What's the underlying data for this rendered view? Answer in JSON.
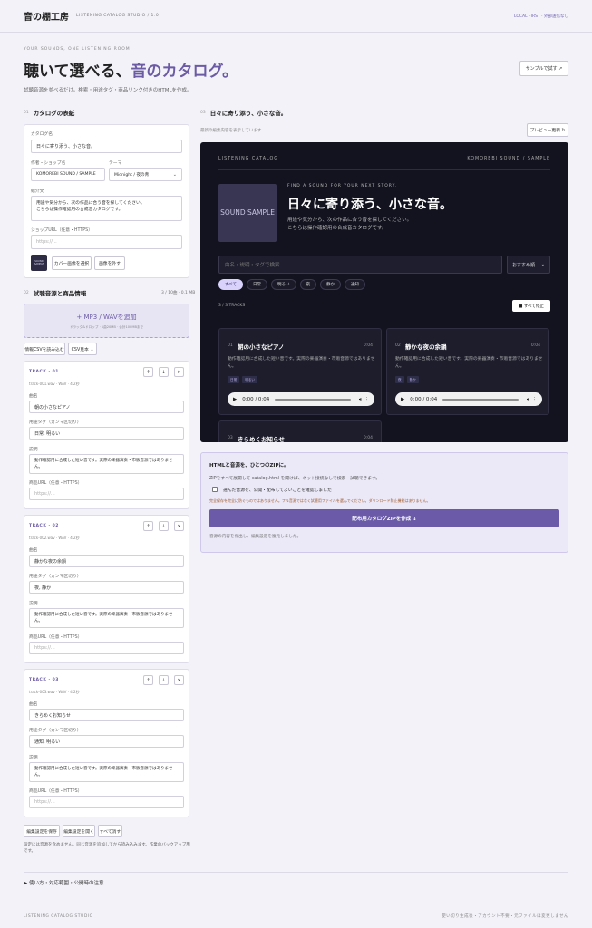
{
  "header": {
    "logo": "音の棚工房",
    "subtitle": "LISTENING CATALOG STUDIO / 1.0",
    "right": "LOCAL FIRST · 外部送信なし"
  },
  "hero": {
    "kicker": "YOUR SOUNDS, ONE LISTENING ROOM",
    "title_a": "聴いて選べる、",
    "title_b": "音のカタログ。",
    "subtitle": "試聴音源を並べるだけ。検索・用途タグ・商品リンク付きのHTMLを作成。",
    "sample_button": "サンプルで試す ↗"
  },
  "cover_section": {
    "num": "01",
    "title": "カタログの表紙",
    "catalog_name_label": "カタログ名",
    "catalog_name": "日々に寄り添う、小さな音。",
    "author_label": "作者・ショップ名",
    "author": "KOMOREBI SOUND / SAMPLE",
    "theme_label": "テーマ",
    "theme": "Midnight / 夜の青",
    "intro_label": "紹介文",
    "intro": "用途や気分から、次の作品に合う音を探してください。\nこちらは操作確認用の合成音カタログです。",
    "shop_label": "ショップURL（任意・HTTPS）",
    "shop_placeholder": "https://...",
    "cover_thumb": "SOUND SAMPLE",
    "select_cover": "カバー画像を選択",
    "remove_cover": "画像を外す"
  },
  "tracks_section": {
    "num": "02",
    "title": "試聴音源と商品情報",
    "counter": "3 / 10曲 · 0.1 MB",
    "drop_title": "+ MP3 / WAVを追加",
    "drop_sub": "ドラッグ&ドロップ · 1曲20MB · 合計100MBまで",
    "csv_import": "情報CSVを読み込む",
    "csv_template": "CSV見本 ↓",
    "labels": {
      "name": "曲名",
      "tags": "用途タグ（カンマ区切り）",
      "desc": "説明",
      "url": "商品URL（任意・HTTPS）"
    },
    "url_placeholder": "https://...",
    "tracks": [
      {
        "head": "TRACK · 01",
        "meta": "track-001.wav · WAV · 4.2秒",
        "name": "朝の小さなピアノ",
        "tags": "日常, 明るい",
        "desc": "動作確認用に合成した短い音です。実際の楽器演奏・市販音源ではありません。"
      },
      {
        "head": "TRACK · 02",
        "meta": "track-002.wav · WAV · 4.2秒",
        "name": "静かな夜の余韻",
        "tags": "夜, 静か",
        "desc": "動作確認用に合成した短い音です。実際の楽器演奏・市販音源ではありません。"
      },
      {
        "head": "TRACK · 03",
        "meta": "track-003.wav · WAV · 4.2秒",
        "name": "きらめくお知らせ",
        "tags": "通知, 明るい",
        "desc": "動作確認用に合成した短い音です。実際の楽器演奏・市販音源ではありません。"
      }
    ],
    "icon_up": "↑",
    "icon_down": "↓",
    "icon_remove": "×",
    "save_settings": "編集設定を保存",
    "open_settings": "編集設定を開く",
    "clear_all": "すべて消す",
    "note": "設定には音源を含めません。同じ音源を追加してから読み込みます。作業のバックアップ用です。"
  },
  "preview_section": {
    "num": "03",
    "title": "日々に寄り添う、小さな音。",
    "note": "最新の編集内容を表示しています",
    "refresh": "プレビュー更新 ↻",
    "top_left": "LISTENING CATALOG",
    "top_right": "KOMOREBI SOUND / SAMPLE",
    "cover": "SOUND SAMPLE",
    "kicker": "FIND A SOUND FOR YOUR NEXT STORY.",
    "desc": "用途や気分から、次の作品に合う音を探してください。\nこちらは操作確認用の合成音カタログです。",
    "search_placeholder": "曲名・説明・タグで検索",
    "sort": "おすすめ順",
    "chips": [
      "すべて",
      "日常",
      "明るい",
      "夜",
      "静か",
      "通知"
    ],
    "count": "3 / 3 TRACKS",
    "stop_all": "■ すべて停止",
    "cards": [
      {
        "num": "01",
        "title": "朝の小さなピアノ",
        "dur": "0:04",
        "desc": "動作確認用に合成した短い音です。実際の楽器演奏・市販音源ではありません。",
        "tags": [
          "日常",
          "明るい"
        ],
        "time": "0:00 / 0:04"
      },
      {
        "num": "02",
        "title": "静かな夜の余韻",
        "dur": "0:04",
        "desc": "動作確認用に合成した短い音です。実際の楽器演奏・市販音源ではありません。",
        "tags": [
          "夜",
          "静か"
        ],
        "time": "0:00 / 0:04"
      },
      {
        "num": "03",
        "title": "きらめくお知らせ",
        "dur": "0:04"
      }
    ]
  },
  "zip": {
    "title": "HTMLと音源を、ひとつのZIPに。",
    "sub": "ZIPをすべて展開して catalog.html を開けば、ネット接続なしで検索・試聴できます。",
    "confirm": "選んだ音源を、公開・配布してよいことを確認しました",
    "warn": "完全保存を完全に防ぐものではありません。フル音源ではなく試聴用ファイルを選んでください。ダウンロード防止機能はありません。",
    "button": "配布用カタログZIPを作成 ↓",
    "status": "音源の内容を保出し、編集設定を復元しました。"
  },
  "help": "▶ 使い方・対応範囲・公開時の注意",
  "footer": {
    "left": "LISTENING CATALOG STUDIO",
    "right": "使い切り生成後・アカウント不要・元ファイルは変更しません"
  },
  "colors": {
    "accent": "#6b5ba5",
    "preview_bg": "#13131f",
    "page_bg": "#f3f2f8"
  }
}
